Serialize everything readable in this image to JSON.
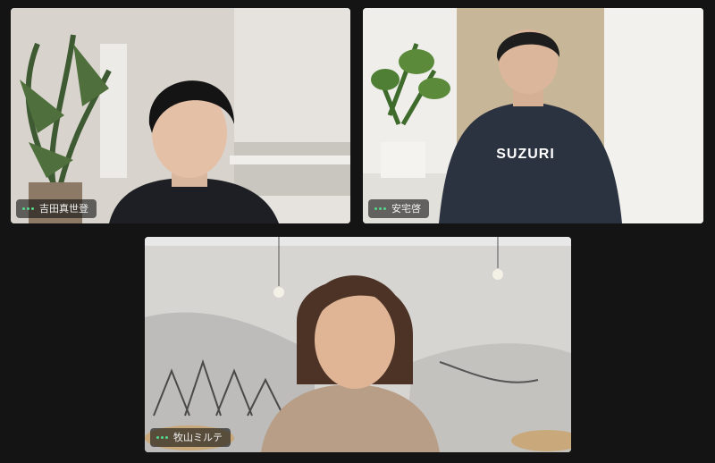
{
  "participants": [
    {
      "name": "吉田真世登",
      "audio_icon": "audio-level-dots-icon"
    },
    {
      "name": "安宅啓",
      "audio_icon": "audio-level-dots-icon",
      "hoodie_text": "SUZURI"
    },
    {
      "name": "牧山ミルテ",
      "audio_icon": "audio-level-dots-icon"
    }
  ],
  "colors": {
    "background": "#141414",
    "audio_indicator": "#54d98c"
  }
}
